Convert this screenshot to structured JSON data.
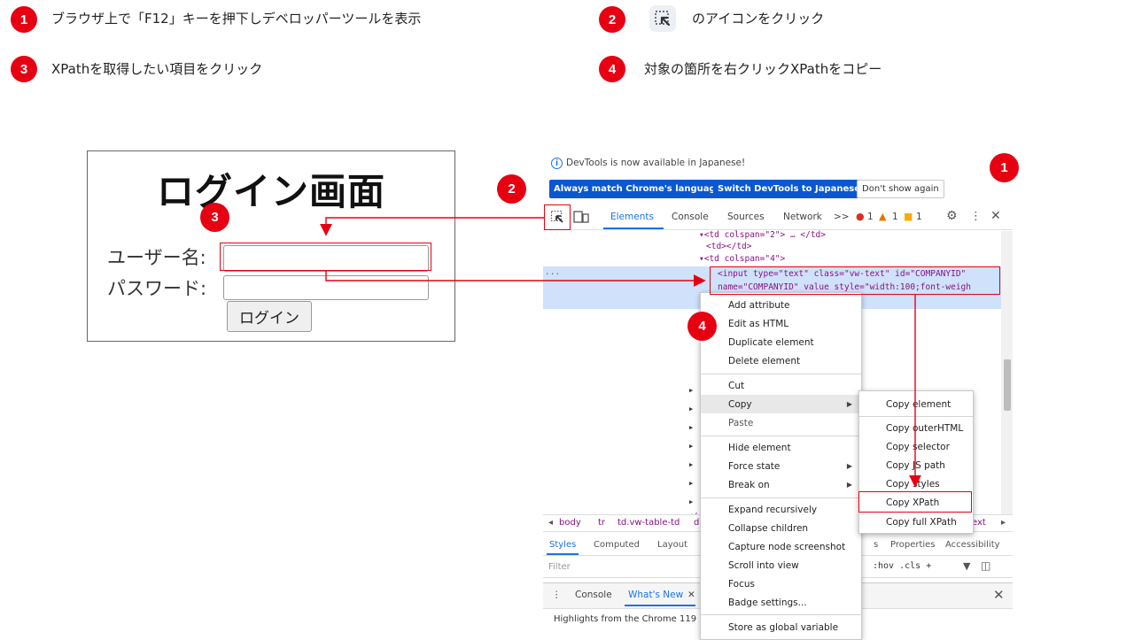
{
  "steps": [
    {
      "number": "1",
      "text": "ブラウザ上で「F12」キーを押下しデベロッパーツールを表示"
    },
    {
      "number": "2",
      "text": "のアイコンをクリック",
      "icon": "element-picker-icon"
    },
    {
      "number": "3",
      "text": "XPathを取得したい項目をクリック"
    },
    {
      "number": "4",
      "text": "対象の箇所を右クリックXPathをコピー"
    }
  ],
  "login": {
    "title": "ログイン画面",
    "username_label": "ユーザー名:",
    "password_label": "パスワード:",
    "username_value": "",
    "password_value": "",
    "button_label": "ログイン"
  },
  "devtools": {
    "info_message": "DevTools is now available in Japanese!",
    "info_buttons": [
      "Always match Chrome's language",
      "Switch DevTools to Japanese",
      "Don't show again"
    ],
    "tabs": [
      "Elements",
      "Console",
      "Sources",
      "Network"
    ],
    "more_tabs": ">>",
    "counts": {
      "errors": "1",
      "warnings": "1",
      "issues": "1"
    },
    "code_lines": [
      {
        "text": "▾<td colspan=\"2\"> … </td>"
      },
      {
        "text": "<td></td>"
      },
      {
        "text": "▾<td colspan=\"4\">"
      },
      {
        "text": "<input type=\"text\" class=\"vw-text\" id=\"COMPANYID\""
      },
      {
        "text": "name=\"COMPANYID\" value style=\"width:100;font-weigh"
      }
    ],
    "ellipsis": "...",
    "breadcrumbs": [
      "body",
      "tr",
      "td.vw-table-td",
      "d"
    ],
    "breadcrumb_tail": "ext",
    "style_tabs": [
      "Styles",
      "Computed",
      "Layout",
      "s",
      "Properties",
      "Accessibility"
    ],
    "filter_placeholder": "Filter",
    "filter_tools": ":hov .cls +",
    "drawer_tabs": [
      "Console",
      "What's New"
    ],
    "drawer_text": "Highlights from the Chrome 119"
  },
  "context_menu": {
    "items": [
      {
        "label": "Add attribute"
      },
      {
        "label": "Edit as HTML"
      },
      {
        "label": "Duplicate element"
      },
      {
        "label": "Delete element"
      },
      {
        "label": "Cut"
      },
      {
        "label": "Copy",
        "submenu": true,
        "highlighted": true
      },
      {
        "label": "Paste"
      },
      {
        "label": "Hide element"
      },
      {
        "label": "Force state",
        "submenu": true
      },
      {
        "label": "Break on",
        "submenu": true
      },
      {
        "label": "Expand recursively"
      },
      {
        "label": "Collapse children"
      },
      {
        "label": "Capture node screenshot"
      },
      {
        "label": "Scroll into view"
      },
      {
        "label": "Focus"
      },
      {
        "label": "Badge settings..."
      },
      {
        "label": "Store as global variable"
      }
    ]
  },
  "copy_submenu": {
    "items": [
      "Copy element",
      "Copy outerHTML",
      "Copy selector",
      "Copy JS path",
      "Copy styles",
      "Copy XPath",
      "Copy full XPath"
    ],
    "target": "Copy XPath"
  },
  "colors": {
    "badge_red": "#e60012",
    "annotation_red": "#e60012",
    "devtools_blue": "#0b57d0",
    "selection_blue": "#cfe1fb"
  }
}
